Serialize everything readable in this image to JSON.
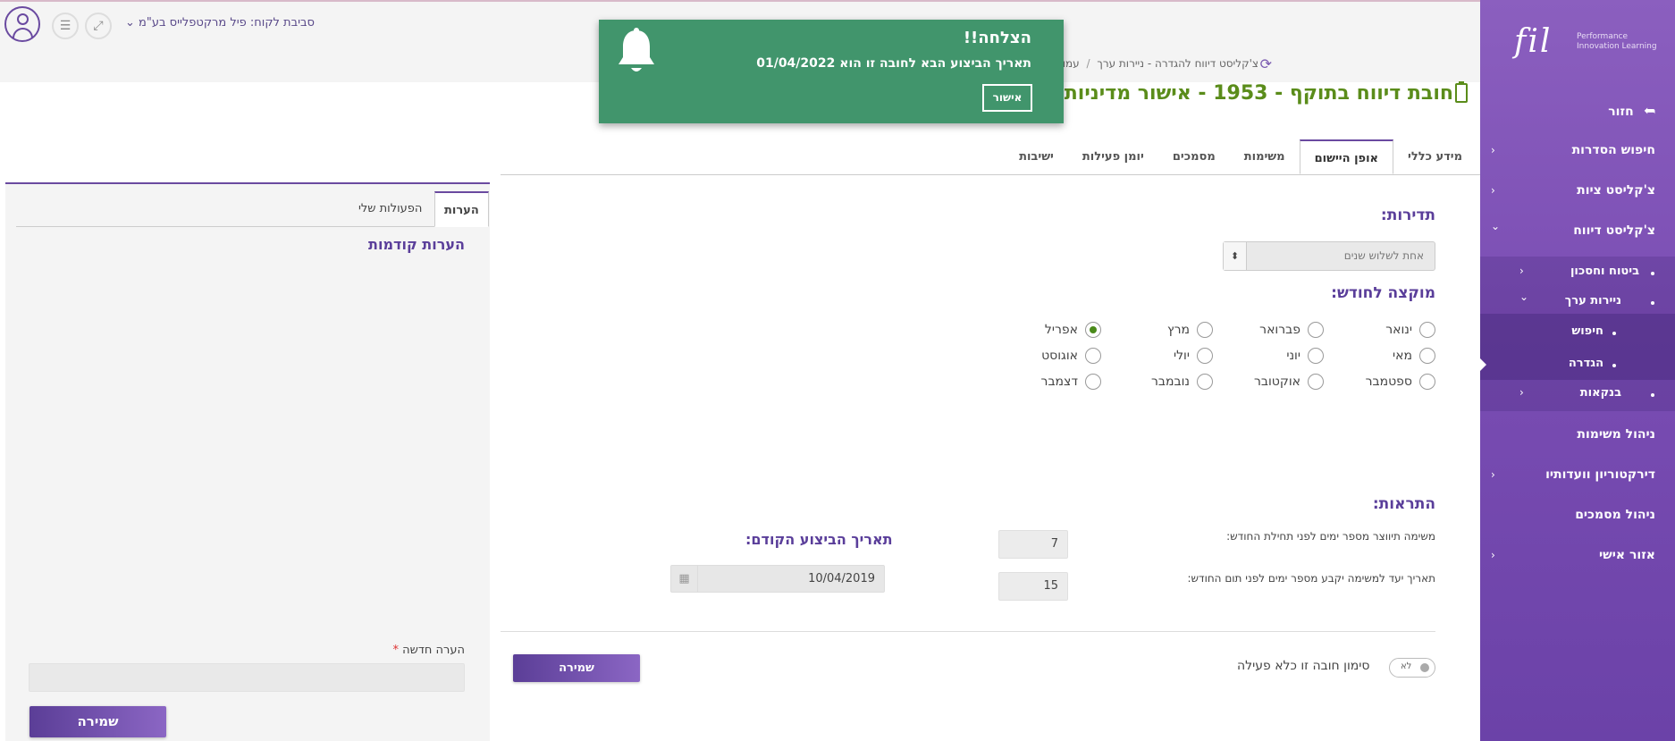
{
  "sidebar": {
    "logo": {
      "mark": "fil",
      "line1": "Performance",
      "line2": "Innovation Learning"
    },
    "back_label": "חזור",
    "items": [
      {
        "label": "חיפוש הסדרות",
        "chevron": "›"
      },
      {
        "label": "צ'קליסט ציות",
        "chevron": "›"
      },
      {
        "label": "צ'קליסט דיווח",
        "chevron": "⌄"
      },
      {
        "label": "ביטוח וחסכון",
        "chevron": "›"
      },
      {
        "label": "ניירות ערך",
        "chevron": "⌄"
      },
      {
        "label": "חיפוש"
      },
      {
        "label": "הגדרה"
      },
      {
        "label": "בנקאות",
        "chevron": "›"
      },
      {
        "label": "ניהול משימות"
      },
      {
        "label": "דירקטוריון וועדותיו",
        "chevron": "›"
      },
      {
        "label": "ניהול מסמכים"
      },
      {
        "label": "אזור אישי",
        "chevron": "›"
      }
    ]
  },
  "header": {
    "client_select": "סביבת לקוח: פיל מרקטפלייס בע\"מ",
    "client_chevron": "⌄",
    "menu_glyph": "☰",
    "fullscreen_glyph": "⤢",
    "breadcrumb": [
      "צ'קליסט דיווח להגדרה - ניירות ערך",
      "עמוד חובת דיווח"
    ],
    "breadcrumb_sep": "/",
    "refresh_glyph": "⟳",
    "page_title": "חובת דיווח בתוקף - 1953 - אישור מדיניות"
  },
  "tabs": [
    "מידע כללי",
    "אופן היישום",
    "משימות",
    "מסמכים",
    "יומן פעילות",
    "ישיבות"
  ],
  "active_tab": "אופן היישום",
  "form": {
    "frequency_title": "תדירות:",
    "frequency_value": "אחת לשלוש שנים",
    "frequency_arrow": "⬍",
    "month_title": "מוקצה לחודש:",
    "months": [
      {
        "label": "ינואר",
        "checked": false
      },
      {
        "label": "פברואר",
        "checked": false
      },
      {
        "label": "מרץ",
        "checked": false
      },
      {
        "label": "אפריל",
        "checked": true
      },
      {
        "label": "מאי",
        "checked": false
      },
      {
        "label": "יוני",
        "checked": false
      },
      {
        "label": "יולי",
        "checked": false
      },
      {
        "label": "אוגוסט",
        "checked": false
      },
      {
        "label": "ספטמבר",
        "checked": false
      },
      {
        "label": "אוקטובר",
        "checked": false
      },
      {
        "label": "נובמבר",
        "checked": false
      },
      {
        "label": "דצמבר",
        "checked": false
      }
    ],
    "alerts_title": "התראות:",
    "alert_create_label": "משימה תיווצר מספר ימים לפני תחילת החודש:",
    "alert_create_value": "7",
    "alert_due_label": "תאריך יעד למשימה יקבע מספר ימים לפני תום החודש:",
    "alert_due_value": "15",
    "prev_date_label": "תאריך הביצוע הקודם:",
    "prev_date_value": "10/04/2019",
    "calendar_glyph": "▦",
    "inactive_label": "סימון חובה זו כלא פעילה",
    "toggle_text": "לא",
    "save_label": "שמירה"
  },
  "comments": {
    "tabs": [
      "הערות",
      "הפעולות שלי"
    ],
    "prev_title": "הערות קודמות",
    "new_label": "הערה חדשה",
    "required_mark": "*",
    "save_label": "שמירה"
  },
  "toast": {
    "title": "הצלחה!!",
    "message": "תאריך הביצוע הבא לחובה זו הוא 01/04/2022",
    "button": "אישור"
  }
}
